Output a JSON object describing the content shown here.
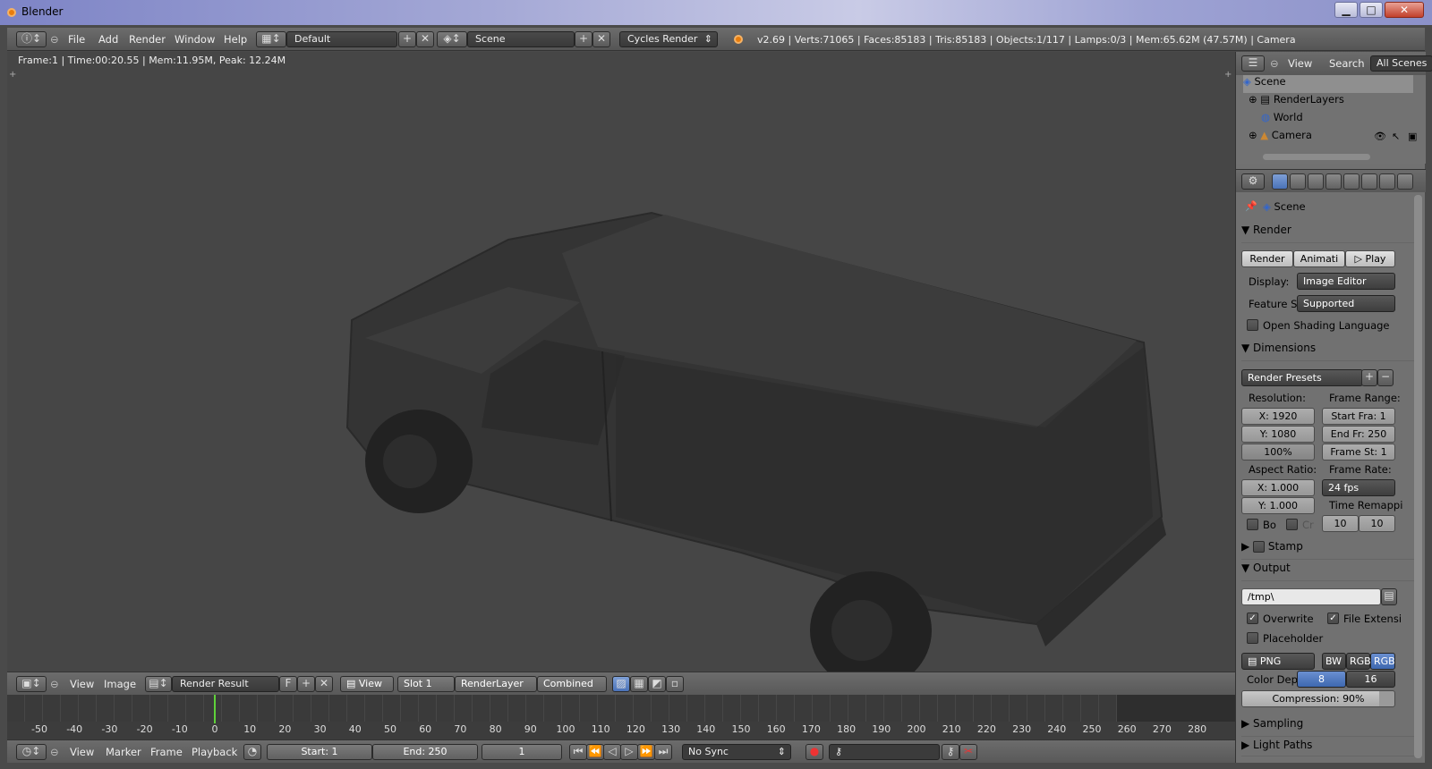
{
  "window": {
    "title": "Blender",
    "minimize": "▁",
    "maximize": "□",
    "close": "✕"
  },
  "info_header": {
    "menus": [
      "File",
      "Add",
      "Render",
      "Window",
      "Help"
    ],
    "layout": "Default",
    "scene": "Scene",
    "engine": "Cycles Render",
    "stats": "v2.69 | Verts:71065 | Faces:85183 | Tris:85183 | Objects:1/117 | Lamps:0/3 | Mem:65.62M (47.57M) | Camera"
  },
  "viewport": {
    "render_info": "Frame:1 | Time:00:20.55 | Mem:11.95M, Peak: 12.24M"
  },
  "image_editor": {
    "menus": [
      "View",
      "Image"
    ],
    "image_name": "Render Result",
    "fake_user": "F",
    "view": "View",
    "slot": "Slot 1",
    "layer": "RenderLayer",
    "pass": "Combined"
  },
  "timeline": {
    "ticks": [
      "-50",
      "-40",
      "-30",
      "-20",
      "-10",
      "0",
      "10",
      "20",
      "30",
      "40",
      "50",
      "60",
      "70",
      "80",
      "90",
      "100",
      "110",
      "120",
      "130",
      "140",
      "150",
      "160",
      "170",
      "180",
      "190",
      "200",
      "210",
      "220",
      "230",
      "240",
      "250",
      "260",
      "270",
      "280"
    ],
    "current_frame_value": 0,
    "menus": [
      "View",
      "Marker",
      "Frame",
      "Playback"
    ],
    "start": "Start: 1",
    "end": "End: 250",
    "current": "1",
    "sync": "No Sync"
  },
  "outliner": {
    "menus": [
      "View",
      "Search"
    ],
    "filter": "All Scenes",
    "items": [
      "Scene",
      "RenderLayers",
      "World",
      "Camera"
    ]
  },
  "properties": {
    "context": "Scene",
    "render_panel": {
      "title": "Render",
      "buttons": [
        "Render",
        "Animati",
        "Play"
      ],
      "display_label": "Display:",
      "display_value": "Image Editor",
      "feature_label": "Feature S",
      "feature_value": "Supported",
      "osl_label": "Open Shading Language"
    },
    "dimensions_panel": {
      "title": "Dimensions",
      "presets": "Render Presets",
      "resolution_label": "Resolution:",
      "res_x": "X: 1920",
      "res_y": "Y: 1080",
      "res_pct": "100%",
      "frame_range_label": "Frame Range:",
      "start_frame": "Start Fra: 1",
      "end_frame": "End Fr: 250",
      "frame_step": "Frame St: 1",
      "aspect_label": "Aspect Ratio:",
      "aspect_x": "X: 1.000",
      "aspect_y": "Y: 1.000",
      "frame_rate_label": "Frame Rate:",
      "frame_rate": "24 fps",
      "time_remap_label": "Time Remappi",
      "remap_old": "10",
      "remap_new": "10",
      "border_label": "Bo",
      "crop_label": "Cr"
    },
    "stamp_panel": {
      "title": "Stamp"
    },
    "output_panel": {
      "title": "Output",
      "path": "/tmp\\",
      "overwrite": "Overwrite",
      "file_ext": "File Extensi",
      "placeholder": "Placeholder",
      "format": "PNG",
      "bw": "BW",
      "rgb": "RGB",
      "rgba": "RGB",
      "color_depth_label": "Color Dep",
      "depth_8": "8",
      "depth_16": "16",
      "compression": "Compression: 90%",
      "compression_value": 0.9
    },
    "sampling_panel": {
      "title": "Sampling"
    },
    "light_paths_panel": {
      "title": "Light Paths"
    }
  }
}
